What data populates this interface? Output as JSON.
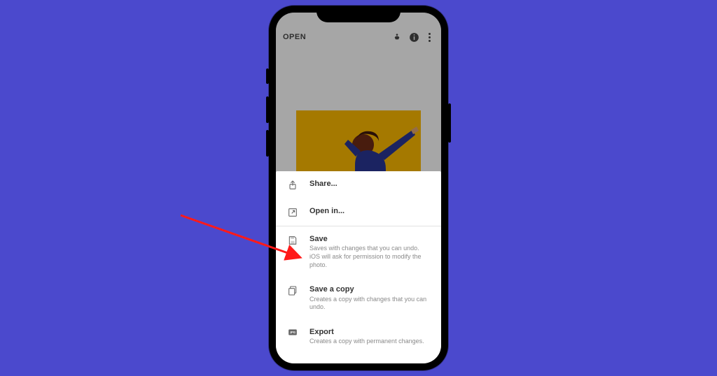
{
  "appbar": {
    "open_label": "OPEN"
  },
  "sheet": {
    "share": {
      "label": "Share..."
    },
    "open_in": {
      "label": "Open in..."
    },
    "save": {
      "label": "Save",
      "sub": "Saves with changes that you can undo. iOS will ask for permission to modify the photo."
    },
    "save_copy": {
      "label": "Save a copy",
      "sub": "Creates a copy with changes that you can undo."
    },
    "export": {
      "label": "Export",
      "sub": "Creates a copy with permanent changes."
    }
  }
}
